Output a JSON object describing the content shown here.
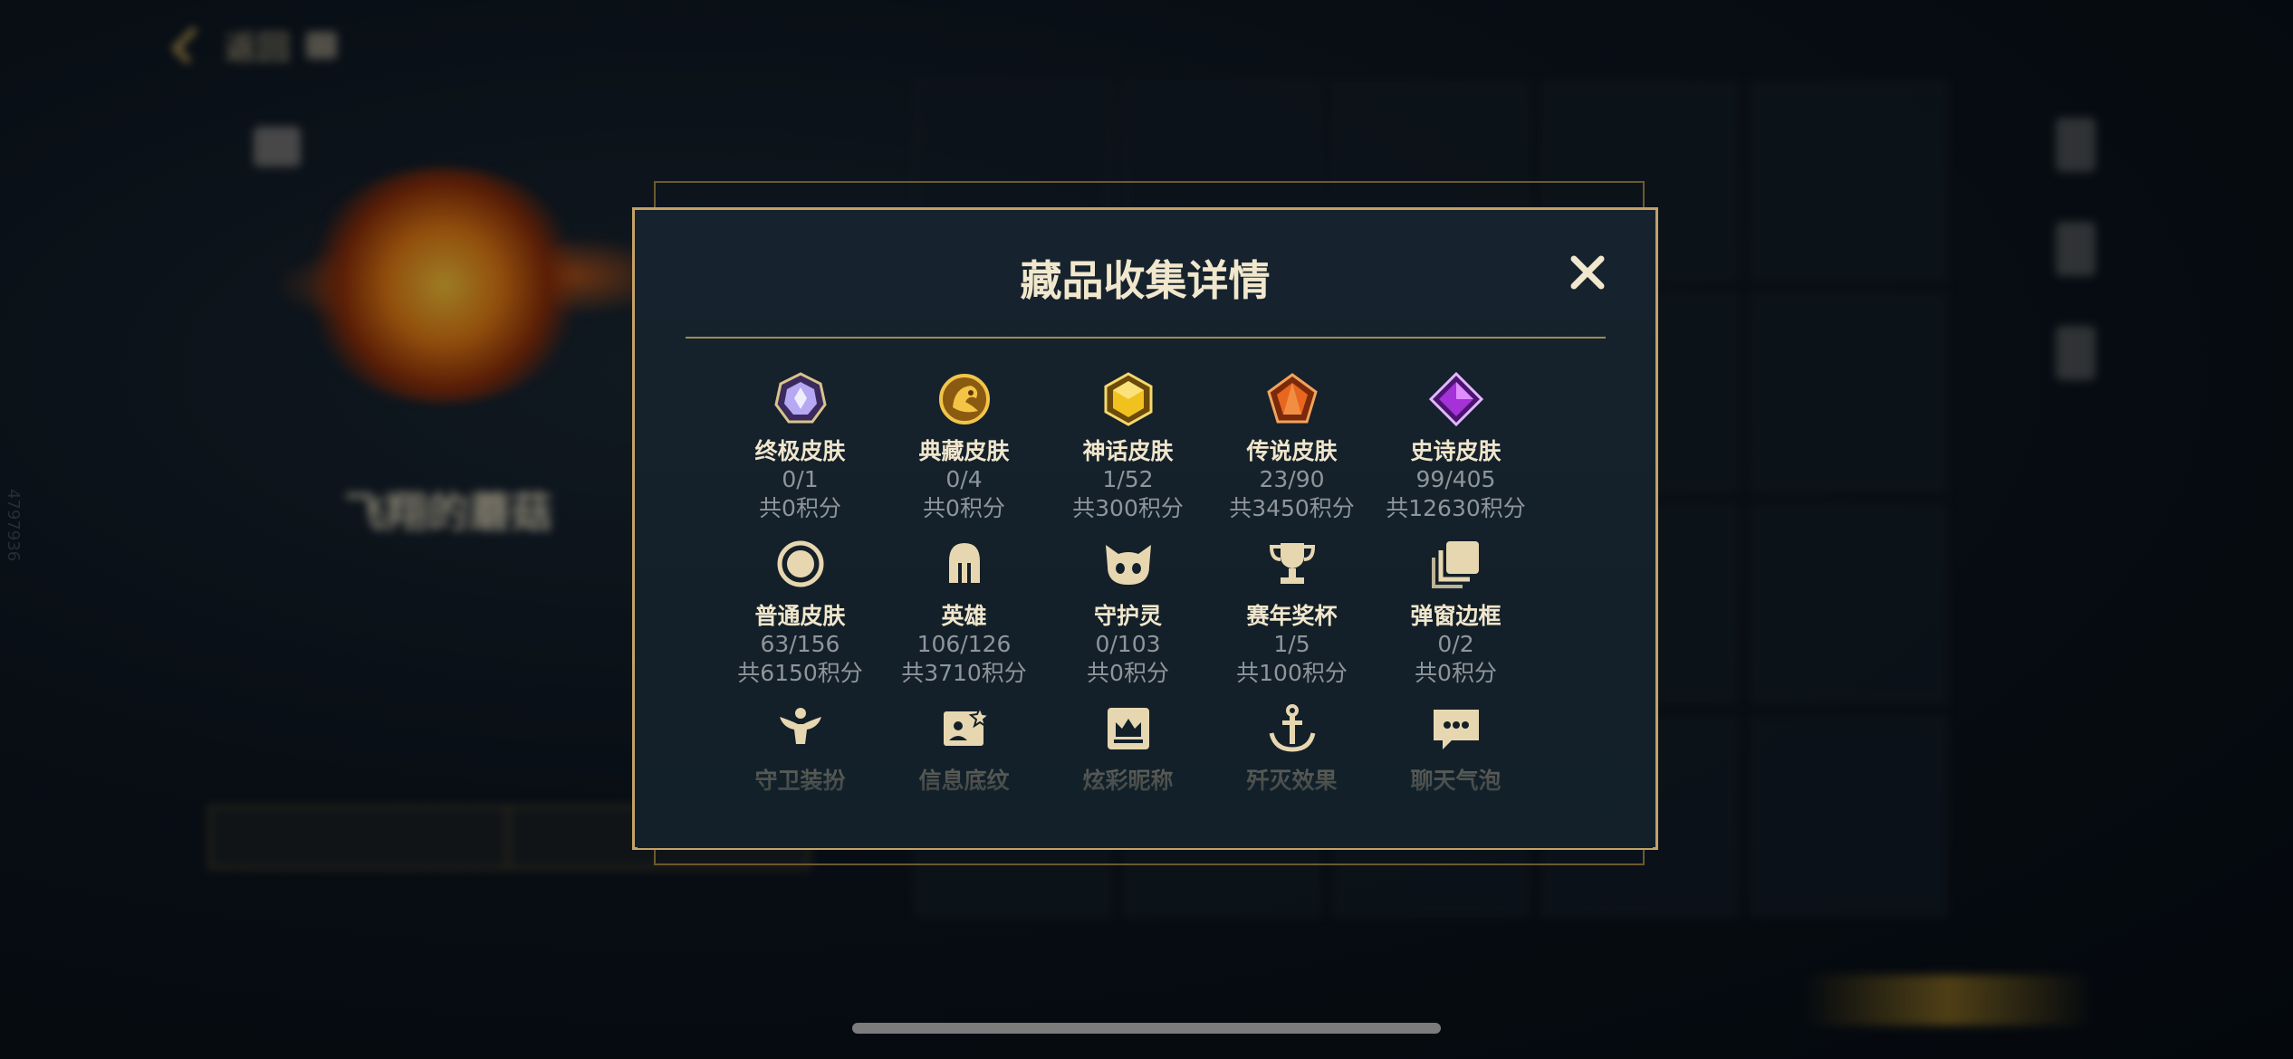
{
  "background": {
    "back_label": "返回",
    "player_name": "飞翔的蘑菇",
    "player_sub": "",
    "side_id": "4797936",
    "bottom_items": [
      "",
      "",
      "",
      ""
    ]
  },
  "modal": {
    "title": "藏品收集详情",
    "close_icon": "close-icon",
    "rows": [
      [
        {
          "label": "终极皮肤",
          "count": "0/1",
          "score": "共0积分",
          "icon": "ultimate-gem-icon",
          "color": "#b6a8f2"
        },
        {
          "label": "典藏皮肤",
          "count": "0/4",
          "score": "共0积分",
          "icon": "dragon-emblem-icon",
          "color": "#e0a628"
        },
        {
          "label": "神话皮肤",
          "count": "1/52",
          "score": "共300积分",
          "icon": "mythic-gem-icon",
          "color": "#f1c21d"
        },
        {
          "label": "传说皮肤",
          "count": "23/90",
          "score": "共3450积分",
          "icon": "legend-gem-icon",
          "color": "#e8661f"
        },
        {
          "label": "史诗皮肤",
          "count": "99/405",
          "score": "共12630积分",
          "icon": "epic-gem-icon",
          "color": "#a531d8"
        }
      ],
      [
        {
          "label": "普通皮肤",
          "count": "63/156",
          "score": "共6150积分",
          "icon": "normal-ring-icon",
          "color": "#e7d7b0"
        },
        {
          "label": "英雄",
          "count": "106/126",
          "score": "共3710积分",
          "icon": "helmet-icon",
          "color": "#e7d7b0"
        },
        {
          "label": "守护灵",
          "count": "0/103",
          "score": "共0积分",
          "icon": "guardian-spirit-icon",
          "color": "#e7d7b0"
        },
        {
          "label": "赛年奖杯",
          "count": "1/5",
          "score": "共100积分",
          "icon": "trophy-icon",
          "color": "#e7d7b0"
        },
        {
          "label": "弹窗边框",
          "count": "0/2",
          "score": "共0积分",
          "icon": "frame-stack-icon",
          "color": "#e7d7b0"
        }
      ],
      [
        {
          "label": "守卫装扮",
          "icon": "guardian-outfit-icon",
          "color": "#e7d7b0"
        },
        {
          "label": "信息底纹",
          "icon": "info-pattern-icon",
          "color": "#e7d7b0"
        },
        {
          "label": "炫彩昵称",
          "icon": "crown-nickname-icon",
          "color": "#e7d7b0"
        },
        {
          "label": "歼灭效果",
          "icon": "anchor-effect-icon",
          "color": "#e7d7b0"
        },
        {
          "label": "聊天气泡",
          "icon": "chat-bubble-icon",
          "color": "#e7d7b0"
        }
      ]
    ]
  }
}
